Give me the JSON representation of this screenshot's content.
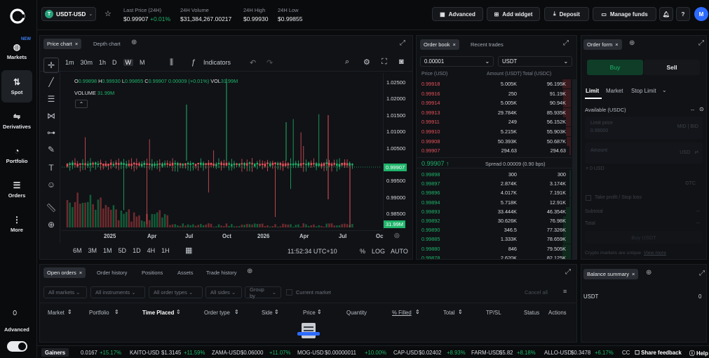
{
  "nav": {
    "items": [
      {
        "label": "Markets",
        "badge": "NEW"
      },
      {
        "label": "Spot"
      },
      {
        "label": "Derivatives"
      },
      {
        "label": "Portfolio"
      },
      {
        "label": "Orders"
      },
      {
        "label": "More"
      }
    ],
    "advanced": "Advanced"
  },
  "header": {
    "pair": "USDT-USD",
    "last_price_label": "Last Price (24H)",
    "last_price": "$0.99907",
    "last_change": "+0.01%",
    "volume_label": "24H Volume",
    "volume": "$31,384,267.00217",
    "high_label": "24H High",
    "high": "$0.99930",
    "low_label": "24H Low",
    "low": "$0.99855",
    "advanced_btn": "Advanced",
    "add_widget_btn": "Add widget",
    "deposit_btn": "Deposit",
    "manage_funds_btn": "Manage funds",
    "avatar": "M"
  },
  "chart_panel": {
    "tabs": [
      "Price chart",
      "Depth chart"
    ],
    "intervals": [
      "1m",
      "30m",
      "1h",
      "D",
      "W",
      "M"
    ],
    "active_interval": "W",
    "indicators_label": "Indicators",
    "ohlc": {
      "o_label": "O",
      "o": "0.99898",
      "h_label": "H",
      "h": "0.99930",
      "l_label": "L",
      "l": "0.99855",
      "c_label": "C",
      "c": "0.99907",
      "chg": "0.00009 (+0.01%)",
      "vol_label": "VOL",
      "vol": "31.99M"
    },
    "volume_label": "VOLUME",
    "volume_val": "31.99M",
    "price_ticks": [
      "1.02500",
      "1.02000",
      "1.01500",
      "1.01000",
      "1.00500",
      "0.99500",
      "0.99000",
      "0.98500"
    ],
    "current_price_tag": "0.99907",
    "volume_tag": "31.99M",
    "time_ticks": [
      "2025",
      "Apr",
      "Jul",
      "Oct",
      "2026",
      "Apr",
      "Jul",
      "Oc"
    ],
    "ranges": [
      "6M",
      "3M",
      "1M",
      "5D",
      "1D",
      "4H",
      "1H"
    ],
    "clock": "11:52:34 UTC+10",
    "pct": "%",
    "log": "LOG",
    "auto": "AUTO"
  },
  "orderbook": {
    "tabs": [
      "Order book",
      "Recent trades"
    ],
    "increment": "0.00001",
    "currency": "USDT",
    "cols": [
      "Price (USD)",
      "Amount (USDT)",
      "Total (USDC)"
    ],
    "asks": [
      [
        "0.99918",
        "5.005K",
        "96.195K"
      ],
      [
        "0.99916",
        "250",
        "91.19K"
      ],
      [
        "0.99914",
        "5.005K",
        "90.94K"
      ],
      [
        "0.99913",
        "29.784K",
        "85.935K"
      ],
      [
        "0.99911",
        "249",
        "56.152K"
      ],
      [
        "0.99910",
        "5.215K",
        "55.903K"
      ],
      [
        "0.99908",
        "50.393K",
        "50.687K"
      ],
      [
        "0.99907",
        "294.63",
        "294.63"
      ]
    ],
    "mid_price": "0.99907 ↑",
    "spread": "Spread 0.00009 (0.90 bps)",
    "bids": [
      [
        "0.99898",
        "300",
        "300"
      ],
      [
        "0.99897",
        "2.874K",
        "3.174K"
      ],
      [
        "0.99896",
        "4.017K",
        "7.191K"
      ],
      [
        "0.99894",
        "5.718K",
        "12.91K"
      ],
      [
        "0.99893",
        "33.444K",
        "46.354K"
      ],
      [
        "0.99892",
        "30.626K",
        "76.98K"
      ],
      [
        "0.99890",
        "346.5",
        "77.326K"
      ],
      [
        "0.99885",
        "1.333K",
        "78.659K"
      ],
      [
        "0.99880",
        "846",
        "79.505K"
      ],
      [
        "0.99878",
        "2.620K",
        "82.125K"
      ]
    ]
  },
  "order_form": {
    "tab": "Order form",
    "buy": "Buy",
    "sell": "Sell",
    "types": [
      "Limit",
      "Market",
      "Stop Limit"
    ],
    "available_label": "Available (USDC)",
    "available_val": "--",
    "limit_placeholder": "Limit price",
    "limit_sub": "0.99000",
    "mid_bid": "MID | BID",
    "amount_label": "Amount",
    "amount_cur": "USD",
    "usd_zero": "= 0 USD",
    "gtc": "GTC",
    "tp_sl": "Take profit / Stop loss",
    "subtotal_label": "Subtotal",
    "subtotal_val": "--",
    "total_label": "Total",
    "total_val": "--",
    "submit": "Buy USDT",
    "disclaimer": "Crypto markets are unique.",
    "view_more": "View more"
  },
  "orders": {
    "tabs": [
      "Open orders",
      "Order history",
      "Positions",
      "Assets",
      "Trade history"
    ],
    "filters": [
      "All markets",
      "All instruments",
      "All order types",
      "All sides",
      "Group by"
    ],
    "current_market": "Current market",
    "cancel_all": "Cancel all",
    "columns": [
      "Market",
      "Portfolio",
      "Time Placed",
      "Order type",
      "Side",
      "Price",
      "Quantity",
      "% Filled",
      "Total",
      "TP/SL",
      "Status",
      "Actions"
    ]
  },
  "balance": {
    "tab": "Balance summary",
    "asset": "USDT",
    "amount": "0"
  },
  "ticker": {
    "label": "Gainers",
    "items": [
      {
        "sym": "",
        "price": "0.0167",
        "chg": "+15.17%"
      },
      {
        "sym": "KAITO-USD",
        "price": "$1.3145",
        "chg": "+11.59%"
      },
      {
        "sym": "ZAMA-USD",
        "price": "$0.06000",
        "chg": "+11.07%"
      },
      {
        "sym": "MOG-USD",
        "price": "$0.00000011",
        "chg": "+10.00%"
      },
      {
        "sym": "CAP-USD",
        "price": "$0.02402",
        "chg": "+8.93%"
      },
      {
        "sym": "FARM-USD",
        "price": "$5.82",
        "chg": "+8.18%"
      },
      {
        "sym": "ALLO-USD",
        "price": "$0.3478",
        "chg": "+6.17%"
      },
      {
        "sym": "CC",
        "price": "",
        "chg": ""
      }
    ],
    "share_feedback": "Share feedback",
    "help": "Help"
  },
  "colors": {
    "green": "#1fb46a",
    "red": "#e5525a",
    "accent": "#2d6bff",
    "panel": "#101216"
  }
}
